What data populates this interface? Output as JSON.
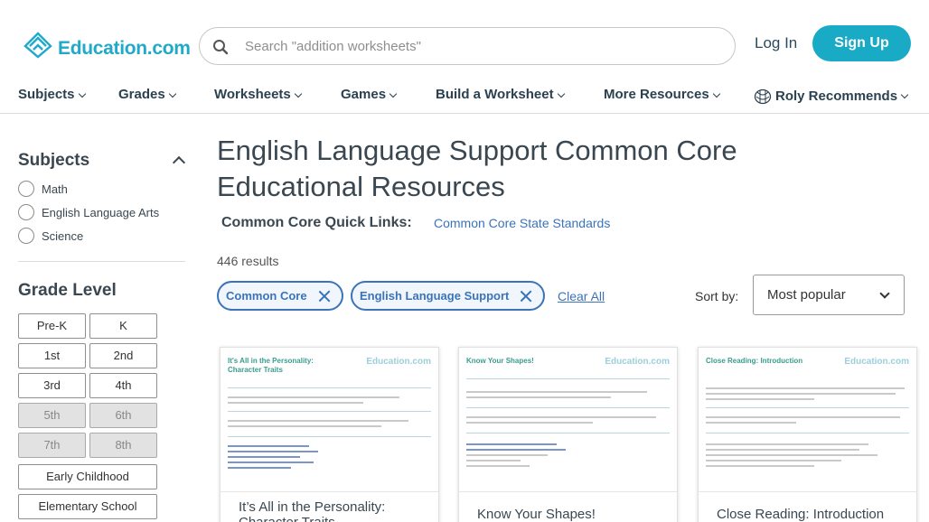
{
  "header": {
    "logo_text": "Education.com",
    "search_placeholder": "Search \"addition worksheets\"",
    "login_label": "Log In",
    "signup_label": "Sign Up"
  },
  "nav": {
    "items": [
      {
        "label": "Subjects"
      },
      {
        "label": "Grades"
      },
      {
        "label": "Worksheets"
      },
      {
        "label": "Games"
      },
      {
        "label": "Build a Worksheet"
      },
      {
        "label": "More Resources"
      },
      {
        "label": "Roly Recommends"
      }
    ]
  },
  "sidebar": {
    "subjects_title": "Subjects",
    "subjects": [
      {
        "label": "Math"
      },
      {
        "label": "English Language Arts"
      },
      {
        "label": "Science"
      }
    ],
    "grade_title": "Grade Level",
    "grades": [
      {
        "label": "Pre-K",
        "disabled": false
      },
      {
        "label": "K",
        "disabled": false
      },
      {
        "label": "1st",
        "disabled": false
      },
      {
        "label": "2nd",
        "disabled": false
      },
      {
        "label": "3rd",
        "disabled": false
      },
      {
        "label": "4th",
        "disabled": false
      },
      {
        "label": "5th",
        "disabled": true
      },
      {
        "label": "6th",
        "disabled": true
      },
      {
        "label": "7th",
        "disabled": true
      },
      {
        "label": "8th",
        "disabled": true
      }
    ],
    "levels": [
      {
        "label": "Early Childhood"
      },
      {
        "label": "Elementary School"
      }
    ]
  },
  "main": {
    "title": "English Language Support Common Core Educational Resources",
    "quick_links_label": "Common Core Quick Links:",
    "quick_link": "Common Core State Standards",
    "results": "446 results",
    "filters": [
      {
        "label": "Common Core"
      },
      {
        "label": "English Language Support"
      }
    ],
    "clear_all": "Clear All",
    "sort_label": "Sort by:",
    "sort_value": "Most popular"
  },
  "cards": [
    {
      "title": "It’s All in the Personality: Character Traits",
      "thumb_heading": "It's All in the Personality: Character Traits",
      "thumb_logo": "Education.com"
    },
    {
      "title": "Know Your Shapes!",
      "thumb_heading": "Know Your Shapes!",
      "thumb_logo": "Education.com"
    },
    {
      "title": "Close Reading: Introduction",
      "thumb_heading": "Close Reading: Introduction",
      "thumb_logo": "Education.com"
    }
  ],
  "colors": {
    "brand": "#20a9c9",
    "signup_bg": "#19aac5",
    "link": "#3b73b9",
    "heading": "#3a4750"
  }
}
